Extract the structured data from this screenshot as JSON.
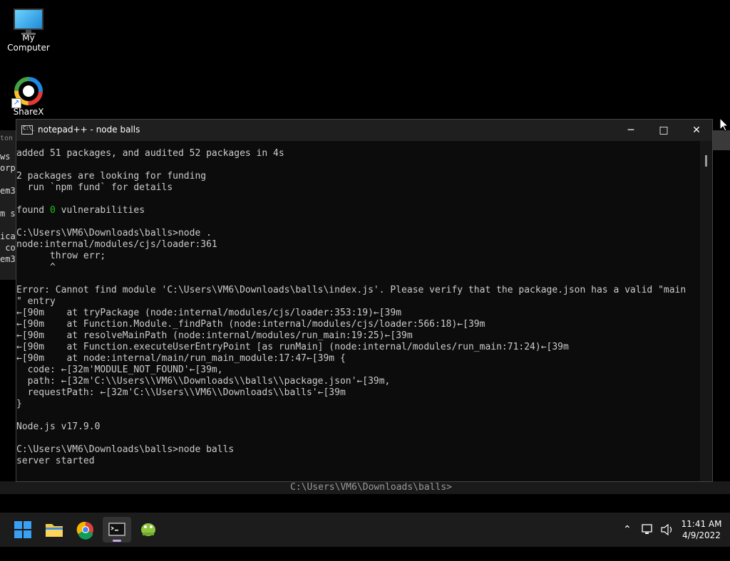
{
  "desktop": {
    "icons": [
      {
        "label": "My Computer",
        "icon": "computer-icon"
      },
      {
        "label": "ShareX",
        "icon": "sharex-icon"
      }
    ],
    "background_window_fragments": [
      "ton",
      "ws",
      "orp",
      "em3",
      "m s",
      "ica",
      " co",
      "em3"
    ]
  },
  "background_status": "C:\\Users\\VM6\\Downloads\\balls>",
  "console": {
    "title": "notepad++ - node  balls",
    "lines": [
      "added 51 packages, and audited 52 packages in 4s",
      "",
      "2 packages are looking for funding",
      "  run `npm fund` for details",
      "",
      "found {g}0{/g} vulnerabilities",
      "",
      "C:\\Users\\VM6\\Downloads\\balls>node .",
      "node:internal/modules/cjs/loader:361",
      "      throw err;",
      "      ^",
      "",
      "Error: Cannot find module 'C:\\Users\\VM6\\Downloads\\balls\\index.js'. Please verify that the package.json has a valid \"main",
      "\" entry",
      "←[90m    at tryPackage (node:internal/modules/cjs/loader:353:19)←[39m",
      "←[90m    at Function.Module._findPath (node:internal/modules/cjs/loader:566:18)←[39m",
      "←[90m    at resolveMainPath (node:internal/modules/run_main:19:25)←[39m",
      "←[90m    at Function.executeUserEntryPoint [as runMain] (node:internal/modules/run_main:71:24)←[39m",
      "←[90m    at node:internal/main/run_main_module:17:47←[39m {",
      "  code: ←[32m'MODULE_NOT_FOUND'←[39m,",
      "  path: ←[32m'C:\\\\Users\\\\VM6\\\\Downloads\\\\balls\\\\package.json'←[39m,",
      "  requestPath: ←[32m'C:\\\\Users\\\\VM6\\\\Downloads\\\\balls'←[39m",
      "}",
      "",
      "Node.js v17.9.0",
      "",
      "C:\\Users\\VM6\\Downloads\\balls>node balls",
      "server started"
    ]
  },
  "taskbar": {
    "apps": [
      "start-icon",
      "file-explorer-icon",
      "chrome-icon",
      "terminal-icon",
      "notepadpp-icon"
    ],
    "clock_time": "11:41 AM",
    "clock_date": "4/9/2022"
  },
  "colors": {
    "console_bg": "#0c0c0c",
    "console_text": "#cccccc",
    "green": "#16c60c",
    "taskbar_bg": "#1c1c1c"
  }
}
